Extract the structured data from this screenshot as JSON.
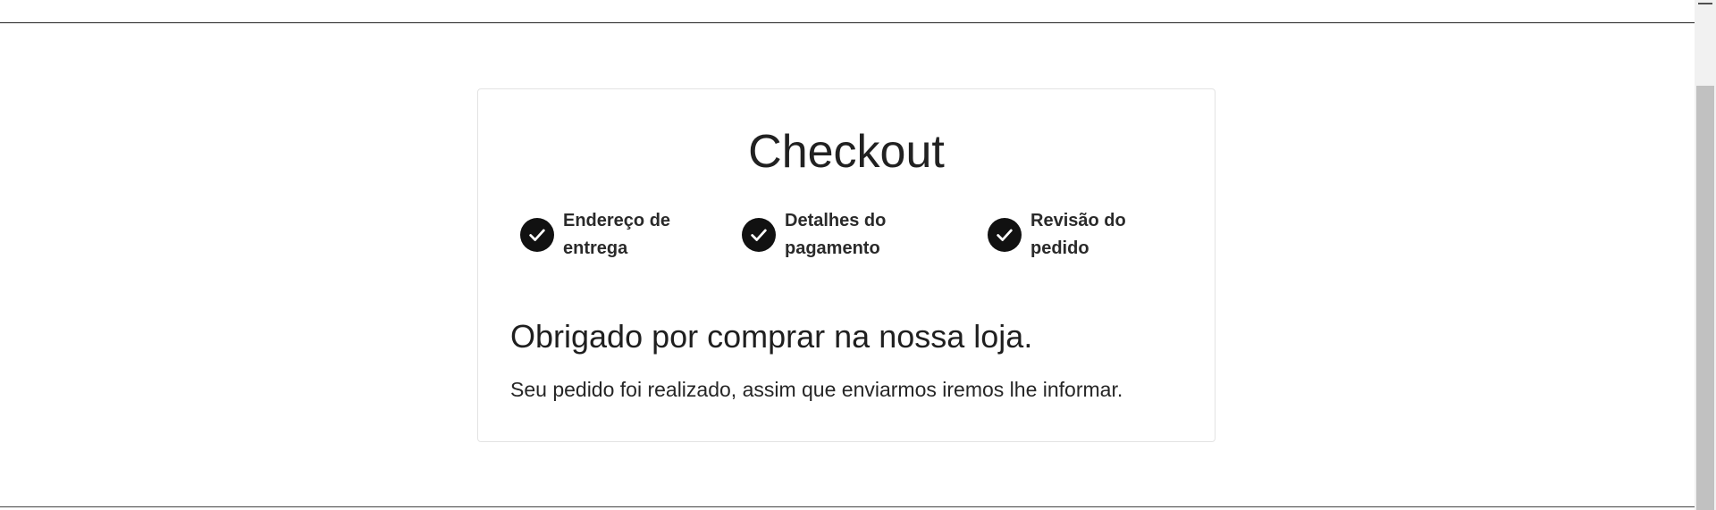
{
  "checkout": {
    "title": "Checkout",
    "steps": [
      {
        "label": "Endereço de entrega",
        "icon": "check-circle-icon",
        "completed": true
      },
      {
        "label": "Detalhes do pagamento",
        "icon": "check-circle-icon",
        "completed": true
      },
      {
        "label": "Revisão do pedido",
        "icon": "check-circle-icon",
        "completed": true
      }
    ],
    "confirmation": {
      "heading": "Obrigado por comprar na nossa loja.",
      "message": "Seu pedido foi realizado, assim que enviarmos iremos lhe informar."
    }
  },
  "colors": {
    "step_icon": "#111111",
    "card_border": "#e3e3e3",
    "text": "#212121"
  }
}
